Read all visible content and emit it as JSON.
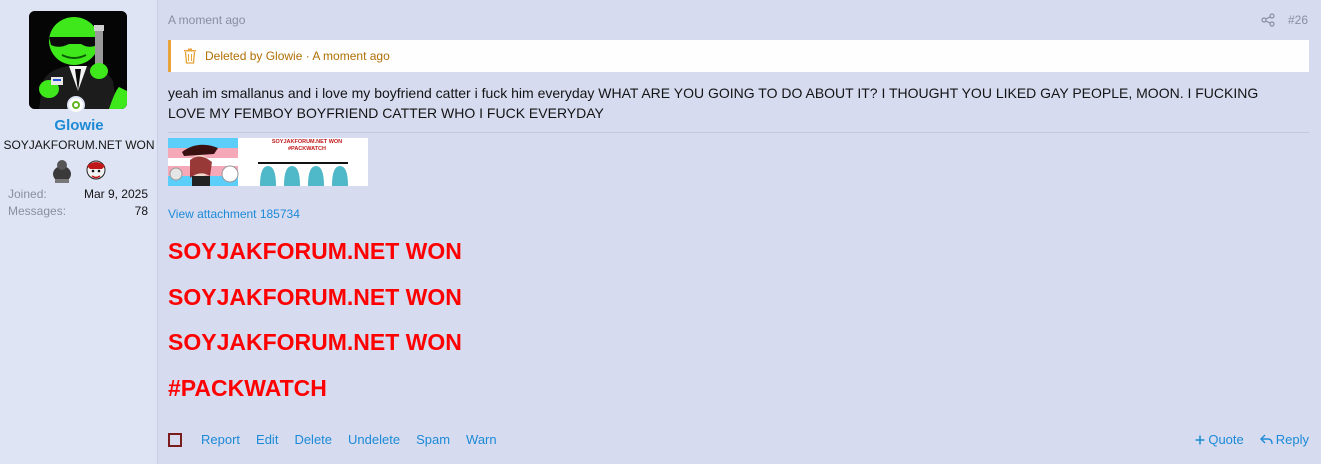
{
  "user": {
    "name": "Glowie",
    "title": "SOYJAKFORUM.NET WON",
    "stats": [
      {
        "label": "Joined:",
        "value": "Mar 9, 2025"
      },
      {
        "label": "Messages:",
        "value": "78"
      }
    ],
    "avatar_badge": "CIA"
  },
  "post": {
    "date": "A moment ago",
    "number": "#26",
    "deleted_notice": "Deleted by Glowie · A moment ago",
    "message": "yeah im smallanus and i love my boyfriend catter i fuck him everyday WHAT ARE YOU GOING TO DO ABOUT IT? I THOUGHT YOU LIKED GAY PEOPLE, MOON. I FUCKING LOVE MY FEMBOY BOYFRIEND CATTER WHO I FUCK EVERYDAY",
    "thumbnail_text": [
      "SOYJAKFORUM.NET WON",
      "#PACKWATCH"
    ],
    "attachment_link": "View attachment 185734",
    "big_lines": [
      "SOYJAKFORUM.NET WON",
      "SOYJAKFORUM.NET WON",
      "SOYJAKFORUM.NET WON",
      "#PACKWATCH"
    ]
  },
  "actions": {
    "left": [
      "Report",
      "Edit",
      "Delete",
      "Undelete",
      "Spam",
      "Warn"
    ],
    "quote": "Quote",
    "reply": "Reply"
  },
  "colors": {
    "link": "#1d8ad6",
    "big_text": "#ff0000",
    "deleted_accent": "#e8a33a",
    "background": "#d6dbf0"
  }
}
